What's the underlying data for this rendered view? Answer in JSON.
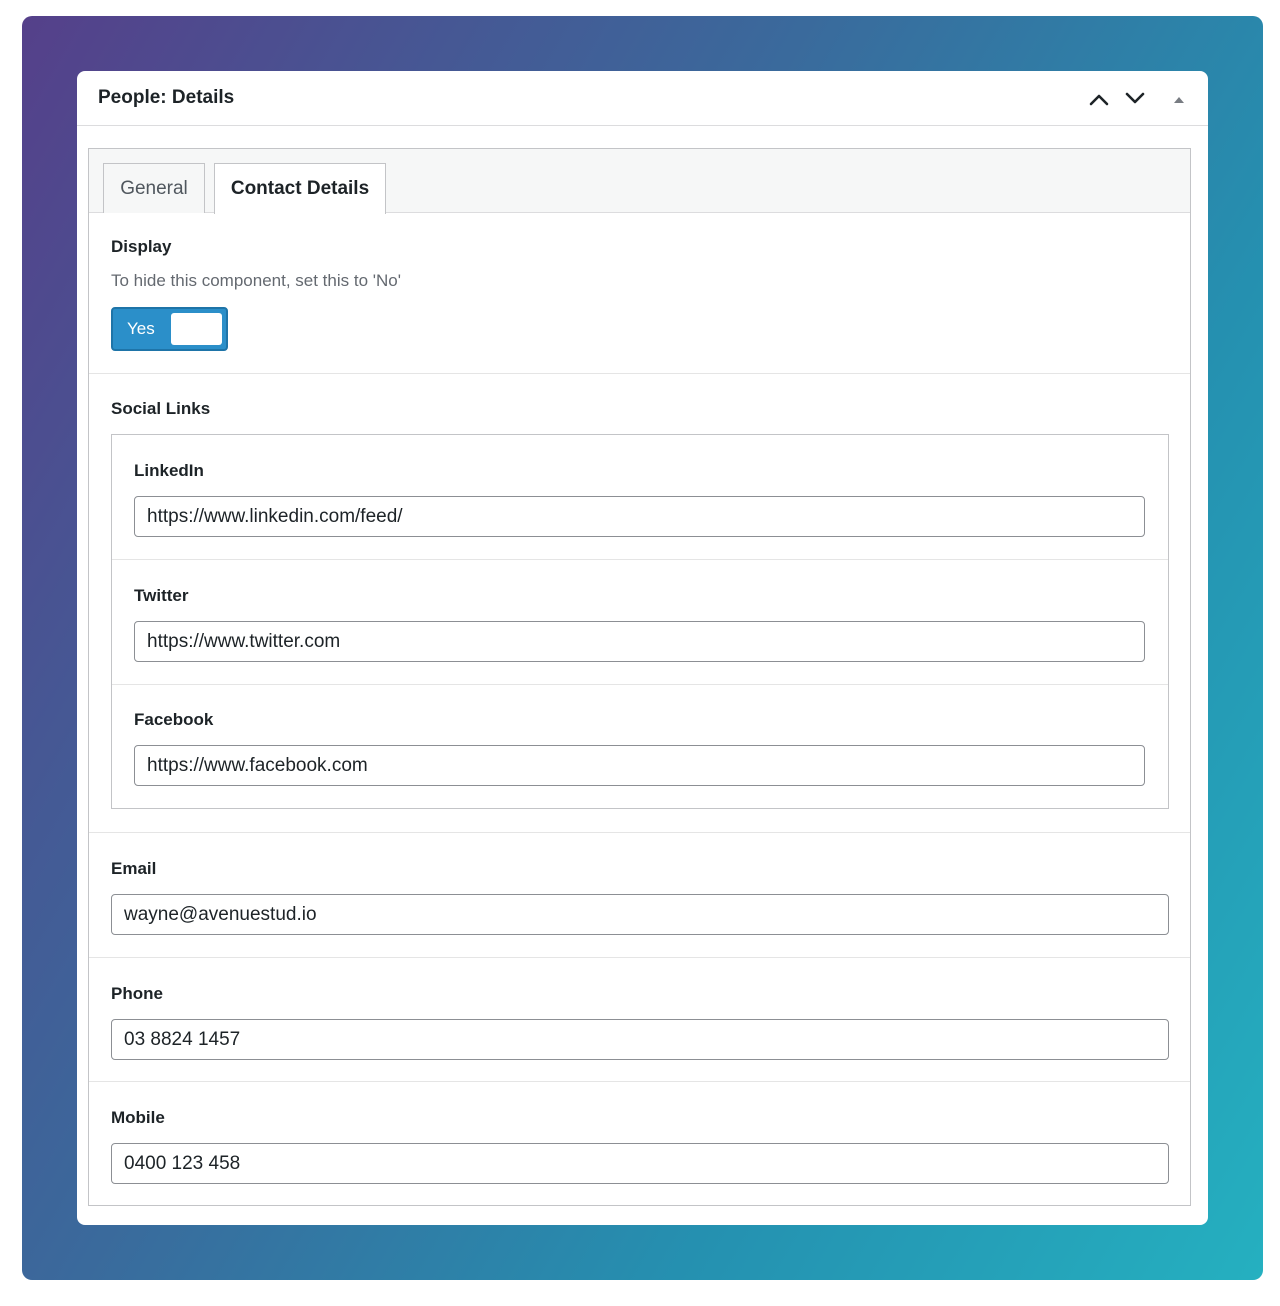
{
  "panel": {
    "title": "People: Details",
    "controls": {
      "move_up_icon": "chevron-up-icon",
      "move_down_icon": "chevron-down-icon",
      "toggle_icon": "triangle-up-icon"
    }
  },
  "tabs": [
    {
      "label": "General",
      "active": false
    },
    {
      "label": "Contact Details",
      "active": true
    }
  ],
  "display": {
    "label": "Display",
    "description": "To hide this component, set this to 'No'",
    "toggle_label": "Yes",
    "toggle_on": true
  },
  "social": {
    "label": "Social Links",
    "linkedin": {
      "label": "LinkedIn",
      "value": "https://www.linkedin.com/feed/"
    },
    "twitter": {
      "label": "Twitter",
      "value": "https://www.twitter.com"
    },
    "facebook": {
      "label": "Facebook",
      "value": "https://www.facebook.com"
    }
  },
  "email": {
    "label": "Email",
    "value": "wayne@avenuestud.io"
  },
  "phone": {
    "label": "Phone",
    "value": "03 8824 1457"
  },
  "mobile": {
    "label": "Mobile",
    "value": "0400 123 458"
  },
  "colors": {
    "accent": "#2b8fc9",
    "gradient_start": "#55408a",
    "gradient_end": "#25b0c0"
  }
}
